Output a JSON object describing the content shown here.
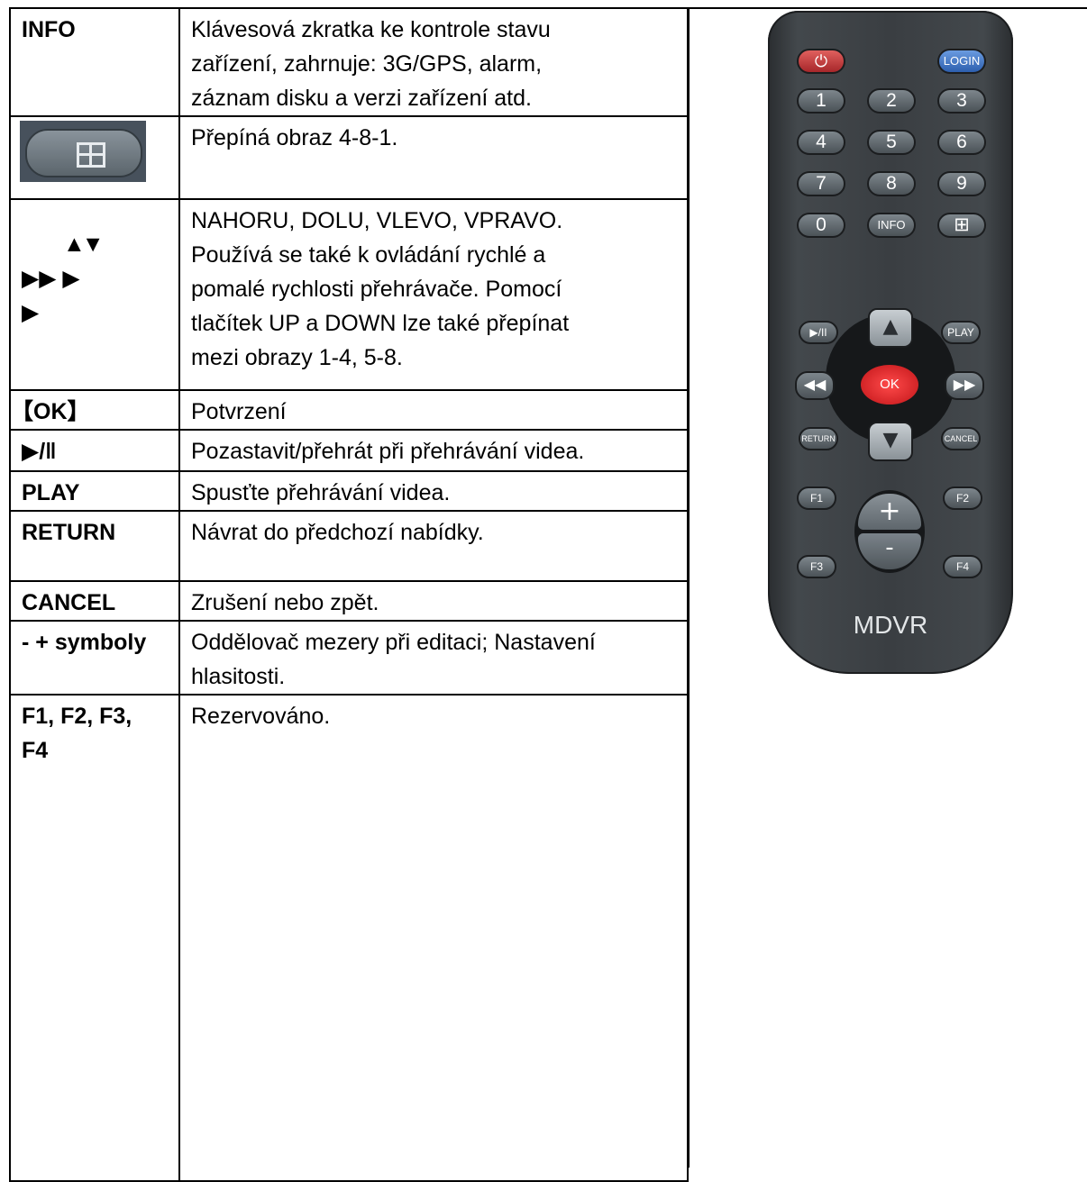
{
  "rows": [
    {
      "key": "INFO",
      "desc": [
        "Klávesová zkratka ke kontrole stavu",
        "zařízení, zahrnuje: 3G/GPS, alarm,",
        "záznam disku a verzi zařízení atd."
      ]
    },
    {
      "key_icon": "grid-split-icon",
      "desc": [
        "Přepíná obraz 4-8-1."
      ]
    },
    {
      "key_arrows": [
        "▲▼",
        "▶▶ ▶",
        "▶"
      ],
      "desc": [
        "NAHORU, DOLU, VLEVO, VPRAVO.",
        "Používá se také k ovládání rychlé a",
        "pomalé rychlosti přehrávače. Pomocí",
        "tlačítek UP a DOWN lze také přepínat",
        "mezi obrazy 1-4, 5-8."
      ]
    },
    {
      "key": "【OK】",
      "desc": [
        "Potvrzení"
      ]
    },
    {
      "key": "▶/‖",
      "desc": [
        "Pozastavit/přehrát při přehrávání videa."
      ]
    },
    {
      "key": "PLAY",
      "desc": [
        "Spusťte přehrávání videa."
      ]
    },
    {
      "key": "RETURN",
      "desc": [
        "Návrat do předchozí nabídky."
      ]
    },
    {
      "key": "CANCEL",
      "desc": [
        "Zrušení nebo zpět."
      ]
    },
    {
      "key": "- + symboly",
      "desc": [
        "Oddělovač mezery při editaci; Nastavení",
        "hlasitosti."
      ]
    },
    {
      "key_lines": [
        "F1, F2, F3,",
        "F4"
      ],
      "desc": [
        "Rezervováno."
      ]
    }
  ],
  "remote": {
    "power": "⏻",
    "login": "LOGIN",
    "numbers": [
      "1",
      "2",
      "3",
      "4",
      "5",
      "6",
      "7",
      "8",
      "9",
      "0"
    ],
    "info": "INFO",
    "grid": "⊞",
    "playpause": "▶/II",
    "play": "PLAY",
    "rewind": "◀◀",
    "ok": "OK",
    "ff": "▶▶",
    "return": "RETURN",
    "cancel": "CANCEL",
    "up": "▲",
    "down": "▼",
    "f1": "F1",
    "f2": "F2",
    "f3": "F3",
    "f4": "F4",
    "plus": "+",
    "minus": "-",
    "brand": "MDVR"
  }
}
